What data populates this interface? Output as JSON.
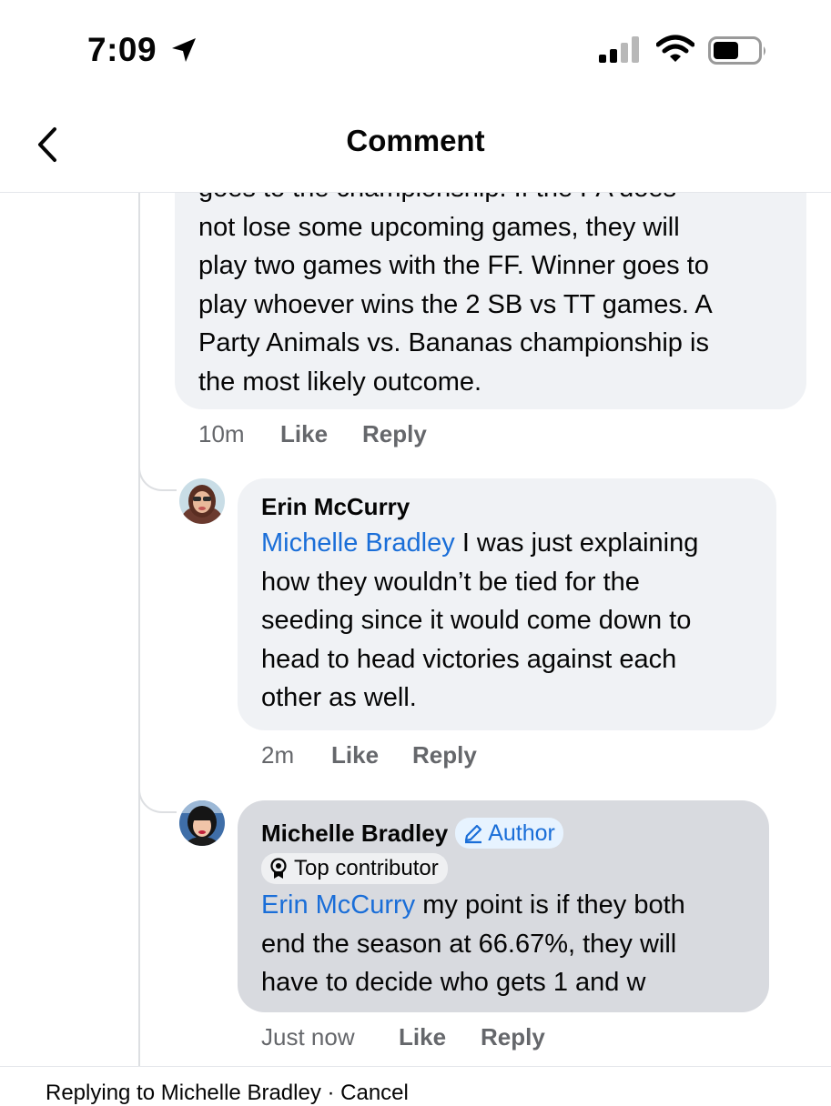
{
  "status_bar": {
    "time": "7:09"
  },
  "header": {
    "title": "Comment"
  },
  "comments": [
    {
      "partial_top_line": "goes to the championship.  If the PA does",
      "lines": [
        "not lose some upcoming games, they will",
        "play two games with the FF.  Winner goes to",
        "play whoever wins the 2 SB vs TT games.  A",
        "Party Animals vs. Bananas championship is",
        "the most likely outcome."
      ],
      "time_ago": "10m",
      "like_label": "Like",
      "reply_label": "Reply"
    },
    {
      "author": "Erin McCurry",
      "mention": "Michelle Bradley",
      "lines": [
        " I was just explaining",
        "how they wouldn’t be tied for the",
        "seeding since it would come down to",
        "head to head victories against each",
        "other as well."
      ],
      "time_ago": "2m",
      "like_label": "Like",
      "reply_label": "Reply"
    },
    {
      "author": "Michelle Bradley",
      "author_badge": "Author",
      "contributor_badge": "Top contributor",
      "mention": "Erin McCurry",
      "lines": [
        " my point is if they both",
        "end the season at 66.67%, they will",
        "have to decide who gets 1 and w"
      ],
      "time_ago": "Just now",
      "like_label": "Like",
      "reply_label": "Reply"
    }
  ],
  "footer": {
    "replying_text": "Replying to Michelle Bradley · Cancel"
  },
  "colors": {
    "mention": "#1a6ed8",
    "bubble": "#f0f2f5",
    "highlight_bubble": "#d8dadf",
    "meta": "#65676b"
  }
}
